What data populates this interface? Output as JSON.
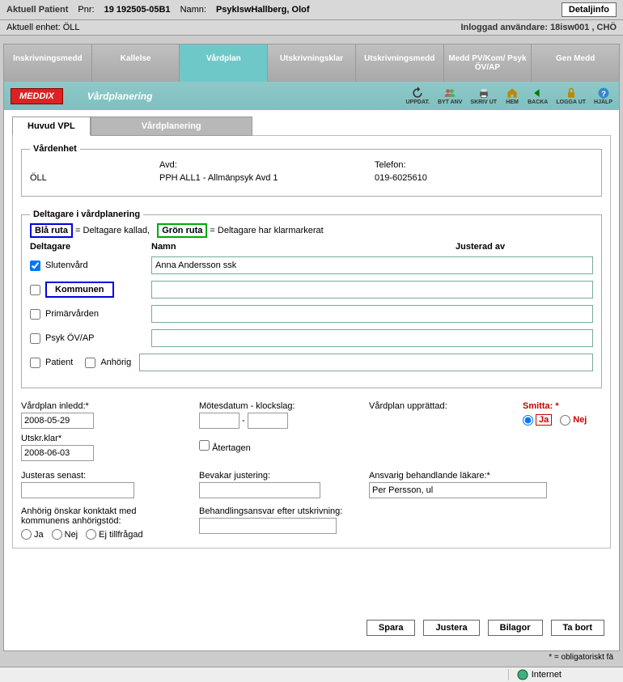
{
  "header": {
    "patient_label": "Aktuell Patient",
    "pnr_label": "Pnr:",
    "pnr_value": "19 192505-05B1",
    "name_label": "Namn:",
    "name_value": "PsykIswHallberg, Olof",
    "detail_btn": "Detaljinfo",
    "unit_label": "Aktuell enhet: ÖLL",
    "logged_in": "Inloggad användare: 18isw001 , CHÖ"
  },
  "top_tabs": [
    "Inskrivningsmedd",
    "Kallelse",
    "Vårdplan",
    "Utskrivningsklar",
    "Utskrivningsmedd",
    "Medd PV/Kom/ Psyk ÖV/AP",
    "Gen Medd"
  ],
  "logo": "MEDDIX",
  "sub_title": "Vårdplanering",
  "toolbar": {
    "uppdat": "UPPDAT.",
    "byt_anv": "BYT ANV",
    "skriv_ut": "SKRIV UT",
    "hem": "HEM",
    "backa": "BACKA",
    "logga_ut": "LOGGA UT",
    "hjalp": "HJÄLP"
  },
  "inner_tabs": {
    "huvud": "Huvud VPL",
    "plan": "Vårdplanering"
  },
  "vardenhet": {
    "legend": "Vårdenhet",
    "unit": "ÖLL",
    "avd_label": "Avd:",
    "avd_value": "PPH ALL1 - Allmänpsyk Avd 1",
    "tel_label": "Telefon:",
    "tel_value": "019-6025610"
  },
  "deltagare": {
    "legend": "Deltagare i vårdplanering",
    "blue": "Blå ruta",
    "blue_note": " = Deltagare kallad,",
    "green": "Grön ruta",
    "green_note": " = Deltagare har klarmarkerat",
    "col_deltagare": "Deltagare",
    "col_namn": "Namn",
    "col_just": "Justerad av",
    "rows": {
      "slutenvard": "Slutenvård",
      "kommunen": "Kommunen",
      "primar": "Primärvården",
      "psyk": "Psyk ÖV/AP",
      "patient": "Patient",
      "anhorig": "Anhörig"
    },
    "name_slutenvard": "Anna Andersson ssk"
  },
  "fields": {
    "inledd_label": "Vårdplan inledd:*",
    "inledd_value": "2008-05-29",
    "motesdatum_label": "Mötesdatum - klockslag:",
    "upprättad_label": "Vårdplan upprättad:",
    "smitta_label": "Smitta: *",
    "ja": "Ja",
    "nej": "Nej",
    "utskrklar_label": "Utskr.klar*",
    "utskrklar_value": "2008-06-03",
    "atertagen_label": "Återtagen",
    "justeras_label": "Justeras senast:",
    "bevakar_label": "Bevakar justering:",
    "ansvarig_label": "Ansvarig behandlande läkare:*",
    "ansvarig_value": "Per Persson, ul",
    "anhorig_kontakt_label": "Anhörig önskar konktakt med kommunens anhörigstöd:",
    "behandling_label": "Behandlingsansvar efter utskrivning:",
    "ej_tillfragad": "Ej tillfrågad"
  },
  "buttons": {
    "spara": "Spara",
    "justera": "Justera",
    "bilagor": "Bilagor",
    "tabort": "Ta bort"
  },
  "footnote": "* = obligatoriskt fä",
  "status": {
    "internet": "Internet"
  }
}
